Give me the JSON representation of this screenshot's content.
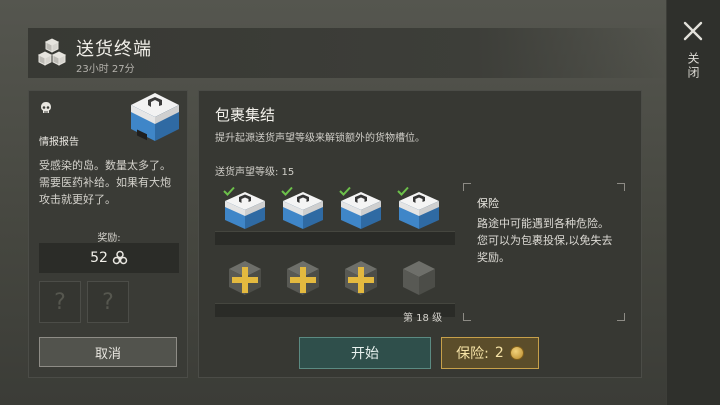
{
  "header": {
    "title": "送货终端",
    "subtitle": "23小时 27分"
  },
  "close": {
    "label": "关闭"
  },
  "report": {
    "title": "情报报告",
    "body": "受感染的岛。数量太多了。需要医药补给。如果有大炮攻击就更好了。",
    "reward_label": "奖励:",
    "reward_value": "52",
    "empty_slot_glyph": "?",
    "cancel_label": "取消"
  },
  "main": {
    "title": "包裹集结",
    "description": "提升起源送货声望等级来解锁额外的货物槽位。",
    "reputation_label": "送货声望等级: 15",
    "unlocked_slots": 4,
    "locked_slots": 4,
    "level_label": "第 18 级",
    "info_title": "保险",
    "info_body": "路途中可能遇到各种危险。您可以为包裹投保,以免失去奖励。",
    "start_label": "开始",
    "insure_label": "保险:",
    "insure_cost": "2"
  },
  "colors": {
    "accent_teal": "#2f4f4b",
    "accent_gold": "#c7a04a",
    "crate_blue": "#3f86c8",
    "check_green": "#6cc04a"
  }
}
